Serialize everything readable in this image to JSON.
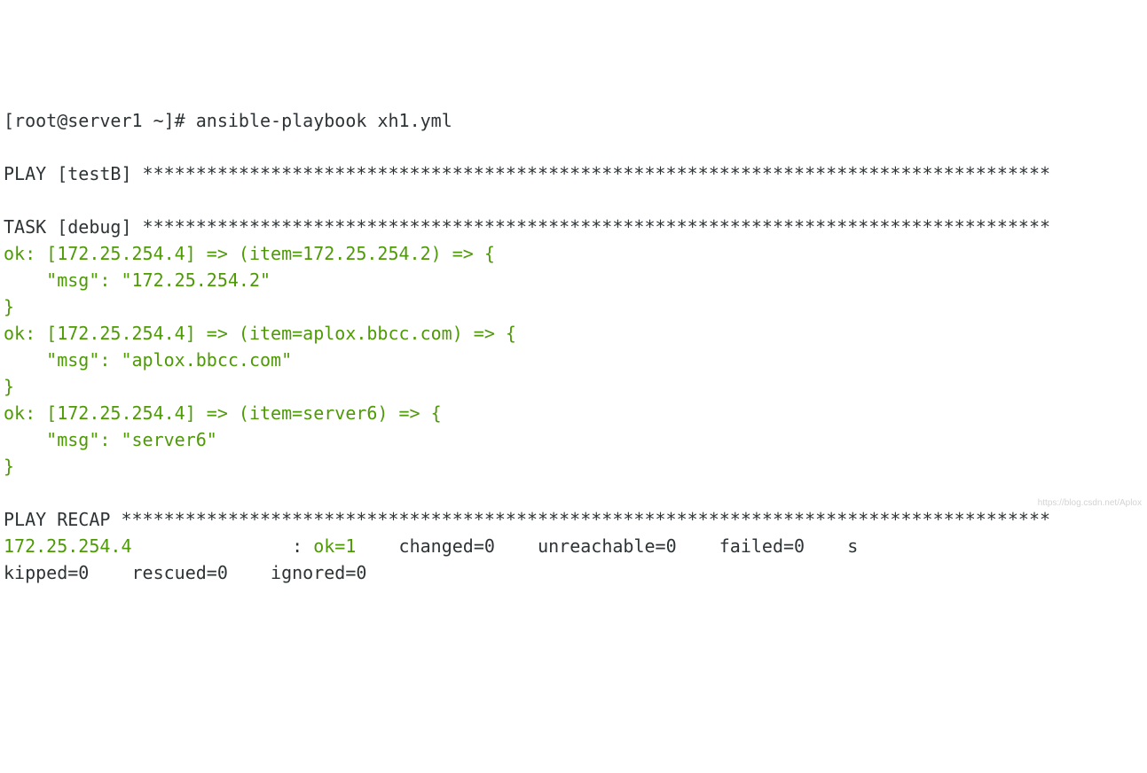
{
  "prompt": "[root@server1 ~]# ",
  "command": "ansible-playbook xh1.yml",
  "blank": "",
  "play_header": "PLAY [testB] *************************************************************************************",
  "task_header": "TASK [debug] *************************************************************************************",
  "ok_lines": {
    "l0": "ok: [172.25.254.4] => (item=172.25.254.2) => {",
    "l1": "    \"msg\": \"172.25.254.2\"",
    "l2": "}",
    "l3": "ok: [172.25.254.4] => (item=aplox.bbcc.com) => {",
    "l4": "    \"msg\": \"aplox.bbcc.com\"",
    "l5": "}",
    "l6": "ok: [172.25.254.4] => (item=server6) => {",
    "l7": "    \"msg\": \"server6\"",
    "l8": "}"
  },
  "recap_header": "PLAY RECAP ***************************************************************************************",
  "recap": {
    "host": "172.25.254.4",
    "space1": "               : ",
    "ok": "ok=1",
    "rest1": "    changed=0    unreachable=0    failed=0    s",
    "rest2": "kipped=0    rescued=0    ignored=0"
  },
  "watermark": "https://blog.csdn.net/Aplox"
}
